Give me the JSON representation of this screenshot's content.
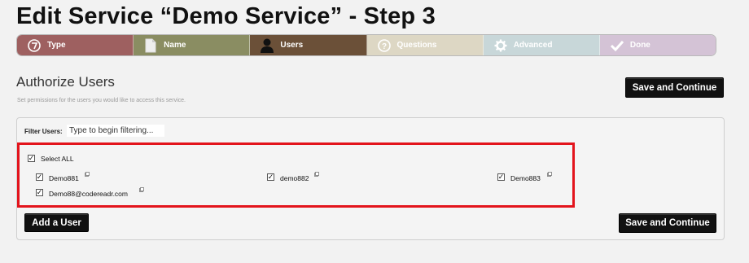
{
  "header": {
    "title": "Edit Service “Demo Service” - Step 3"
  },
  "steps": [
    {
      "label": "Type",
      "icon": "type-icon",
      "color": "#9e6060"
    },
    {
      "label": "Name",
      "icon": "document-icon",
      "color": "#8a8d62"
    },
    {
      "label": "Users",
      "icon": "user-icon",
      "color": "#6b5038"
    },
    {
      "label": "Questions",
      "icon": "question-icon",
      "color": "#ddd7c4"
    },
    {
      "label": "Advanced",
      "icon": "gear-icon",
      "color": "#c8d7d9"
    },
    {
      "label": "Done",
      "icon": "check-icon",
      "color": "#d4c3d6"
    }
  ],
  "section": {
    "title": "Authorize Users",
    "description": "Set permissions for the users you would like to access this service."
  },
  "buttons": {
    "save_continue_top": "Save and Continue",
    "save_continue_bottom": "Save and Continue",
    "add_user": "Add a User"
  },
  "filter": {
    "label": "Filter Users:",
    "placeholder": "Type to begin filtering..."
  },
  "select_all": {
    "label": "Select ALL",
    "checked": true
  },
  "users": [
    {
      "name": "Demo881",
      "checked": true
    },
    {
      "name": "demo882",
      "checked": true
    },
    {
      "name": "Demo883",
      "checked": true
    },
    {
      "name": "Demo88@codereadr.com",
      "checked": true
    }
  ],
  "colors": {
    "highlight": "#e3141c",
    "button": "#111111"
  }
}
